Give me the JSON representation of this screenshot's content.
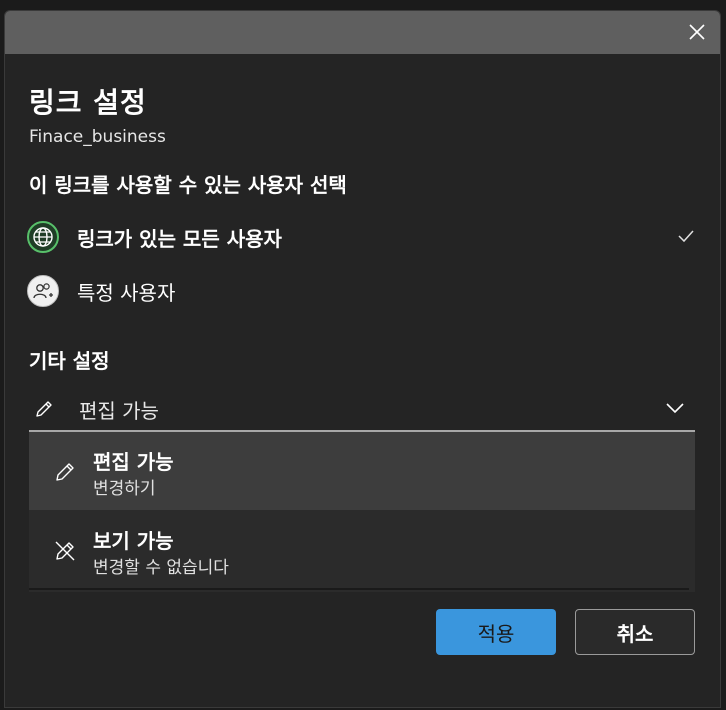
{
  "dialog": {
    "title": "링크 설정",
    "file_name": "Finace_business"
  },
  "access": {
    "heading": "이 링크를 사용할 수 있는 사용자 선택",
    "options": [
      {
        "label": "링크가 있는 모든 사용자",
        "icon": "globe-icon",
        "selected": true
      },
      {
        "label": "특정 사용자",
        "icon": "people-icon",
        "selected": false
      }
    ]
  },
  "other_settings": {
    "heading": "기타 설정",
    "permission_select": {
      "value": "편집 가능",
      "options": [
        {
          "title": "편집 가능",
          "desc": "변경하기",
          "icon": "pencil-icon"
        },
        {
          "title": "보기 가능",
          "desc": "변경할 수 없습니다",
          "icon": "pencil-off-icon"
        }
      ]
    }
  },
  "buttons": {
    "apply": "적용",
    "cancel": "취소"
  },
  "colors": {
    "accent": "#3a96dd",
    "globe_ring": "#58c06a",
    "titlebar": "#5f5f5f",
    "surface": "#242424"
  }
}
